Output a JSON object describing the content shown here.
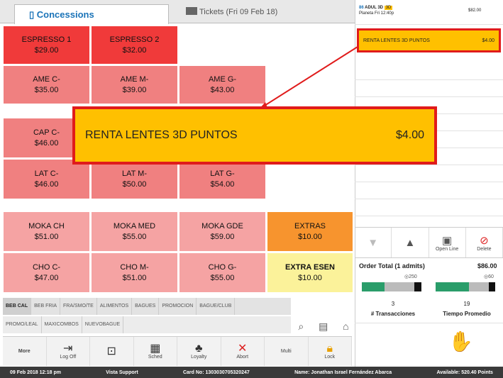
{
  "tabs": {
    "concessions": "Concessions",
    "tickets": "Tickets (Fri 09 Feb 18)"
  },
  "products": [
    {
      "name": "ESPRESSO 1",
      "price": "$29.00"
    },
    {
      "name": "ESPRESSO 2",
      "price": "$32.00"
    },
    {
      "name": "AME C-",
      "price": "$35.00"
    },
    {
      "name": "AME M-",
      "price": "$39.00"
    },
    {
      "name": "AME G-",
      "price": "$43.00"
    },
    {
      "name": "CAP C-",
      "price": "$46.00"
    },
    {
      "name": "LAT C-",
      "price": "$46.00"
    },
    {
      "name": "LAT M-",
      "price": "$50.00"
    },
    {
      "name": "LAT G-",
      "price": "$54.00"
    },
    {
      "name": "MOKA CH",
      "price": "$51.00"
    },
    {
      "name": "MOKA MED",
      "price": "$55.00"
    },
    {
      "name": "MOKA GDE",
      "price": "$59.00"
    },
    {
      "name": "EXTRAS",
      "price": "$10.00"
    },
    {
      "name": "CHO C-",
      "price": "$47.00"
    },
    {
      "name": "CHO M-",
      "price": "$51.00"
    },
    {
      "name": "CHO G-",
      "price": "$55.00"
    },
    {
      "name": "EXTRA ESEN",
      "price": "$10.00"
    }
  ],
  "categories_row1": [
    "BEB CAL",
    "BEB FRIA",
    "FRA/SMO/TE",
    "ALIMENTOS",
    "BAGUES",
    "PROMOCION",
    "BAGUE/CLUB"
  ],
  "categories_row2": [
    "PROMO/LEAL",
    "MAXICOMBOS",
    "NUEVOBAGUE"
  ],
  "toolbar": {
    "more": "More",
    "log_off": "Log Off",
    "sched": "Sched",
    "loyalty": "Loyalty",
    "abort": "Abort",
    "multi": "Multi",
    "lock": "Lock"
  },
  "status": {
    "datetime": "09 Feb 2018 12:18 pm",
    "support": "Vista Support",
    "card": "Card No: 1303030705320247",
    "name": "Name: Jonathan Israel Fernández Abarca",
    "available": "Available: 520.40 Points"
  },
  "order": {
    "ticket_title": "ADUL 3D",
    "ticket_sub": "Planeta Fri 12:40p",
    "ticket_price": "$82.00",
    "highlight_item": "RENTA LENTES  3D PUNTOS",
    "highlight_price": "$4.00",
    "total_label": "Order Total (1 admits)",
    "total_value": "$86.00"
  },
  "controls": {
    "open_line": "Open Line",
    "delete": "Delete"
  },
  "metrics": {
    "trans_value": "3",
    "trans_label": "# Transacciones",
    "trans_target": "250",
    "tiempo_value": "19",
    "tiempo_label": "Tiempo Promedio",
    "tiempo_target": "60"
  },
  "colors": {
    "accent": "#1a73b8",
    "highlight": "#ffc000",
    "callout_border": "#e01b1b"
  }
}
